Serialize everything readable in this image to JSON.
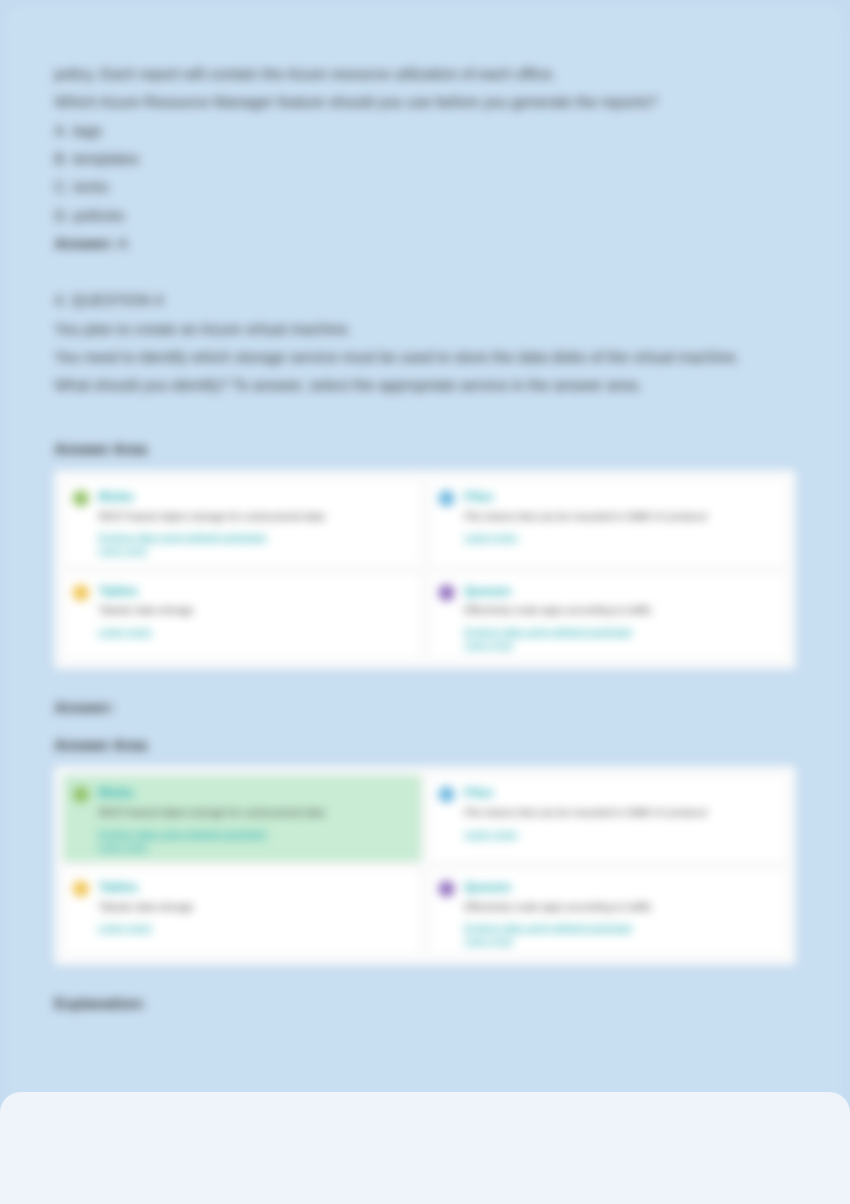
{
  "question1": {
    "lead": "policy. Each report will contain the Azure resource utilization of each office.",
    "prompt": "Which Azure Resource Manager feature should you use before you generate the reports?",
    "opts": {
      "a": "A. tags",
      "b": "B. templates",
      "c": "C. locks",
      "d": "D. policies"
    },
    "answer_label": "Answer:",
    "answer_value": "A"
  },
  "question2": {
    "num": "4. QUESTION 4",
    "l1": "You plan to create an Azure virtual machine.",
    "l2": "You need to identify which storage service must be used to store the data disks of the virtual machine.",
    "l3": "What should you identify? To answer, select the appropriate service in the answer area."
  },
  "area_label": "Answer Area",
  "cards": {
    "blobs": {
      "title": "Blobs",
      "desc": "REST-based object storage for unstructured data",
      "link1": "Explore data using default quickstart",
      "link2": "Learn more"
    },
    "files": {
      "title": "Files",
      "desc": "File shares that can be mounted in SMB 3.0 protocol",
      "link1": "Learn more",
      "link2": ""
    },
    "tables": {
      "title": "Tables",
      "desc": "Tabular data storage",
      "link1": "Learn more",
      "link2": ""
    },
    "queues": {
      "title": "Queues",
      "desc": "Effectively scale apps according to traffic",
      "link1": "Explore data using default quickstart",
      "link2": "Learn more"
    }
  },
  "answer_heading": "Answer:",
  "explanation": "Explanation:",
  "colors": {
    "accent": "#1ba8b0",
    "bg": "#c8def1"
  }
}
